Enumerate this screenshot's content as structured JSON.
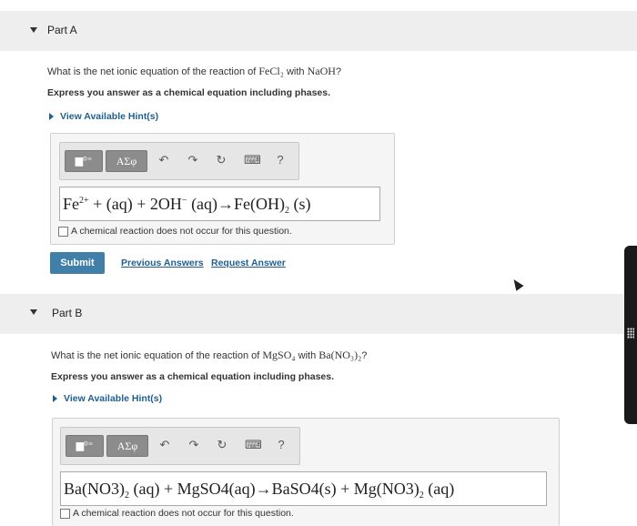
{
  "partA": {
    "title": "Part A",
    "question": {
      "prefix": "What is the net ionic equation of the reaction of ",
      "reactant1": "FeCl₂",
      "mid": " with ",
      "reactant2": "NaOH",
      "suffix": "?"
    },
    "instruction": "Express you answer as a chemical equation including phases.",
    "hint": "View Available Hint(s)",
    "toolbar": {
      "template_label": "▆⁰⁼",
      "greek_label": "ΑΣφ",
      "help_label": "?"
    },
    "answer": {
      "t1": "Fe",
      "sup1": "2+",
      "t2": " + (aq) + 2OH",
      "sup2": "−",
      "t3": " (aq)→Fe(OH)",
      "sub1": "2",
      "t4": " (s)"
    },
    "no_reaction_label": "A chemical reaction does not occur for this question.",
    "submit_label": "Submit",
    "previous_answers_label": "Previous Answers",
    "request_answer_label": "Request Answer"
  },
  "partB": {
    "title": "Part B",
    "question": {
      "prefix": "What is the net ionic equation of the reaction of ",
      "reactant1": "MgSO₄",
      "mid": " with ",
      "reactant2": "Ba(NO₃)₂",
      "suffix": "?"
    },
    "instruction": "Express you answer as a chemical equation including phases.",
    "hint": "View Available Hint(s)",
    "toolbar": {
      "template_label": "▆⁰⁼",
      "greek_label": "ΑΣφ",
      "help_label": "?"
    },
    "answer": {
      "t1": "Ba(NO3)",
      "sub1": "2",
      "t2": " (aq) + MgSO4(aq)→BaSO4(s) + Mg(NO3)",
      "sub2": "2",
      "t3": " (aq)"
    },
    "no_reaction_label": "A chemical reaction does not occur for this question."
  },
  "icons": {
    "undo": "↶",
    "redo": "↷",
    "reset": "↻",
    "keyboard": "⌨"
  }
}
